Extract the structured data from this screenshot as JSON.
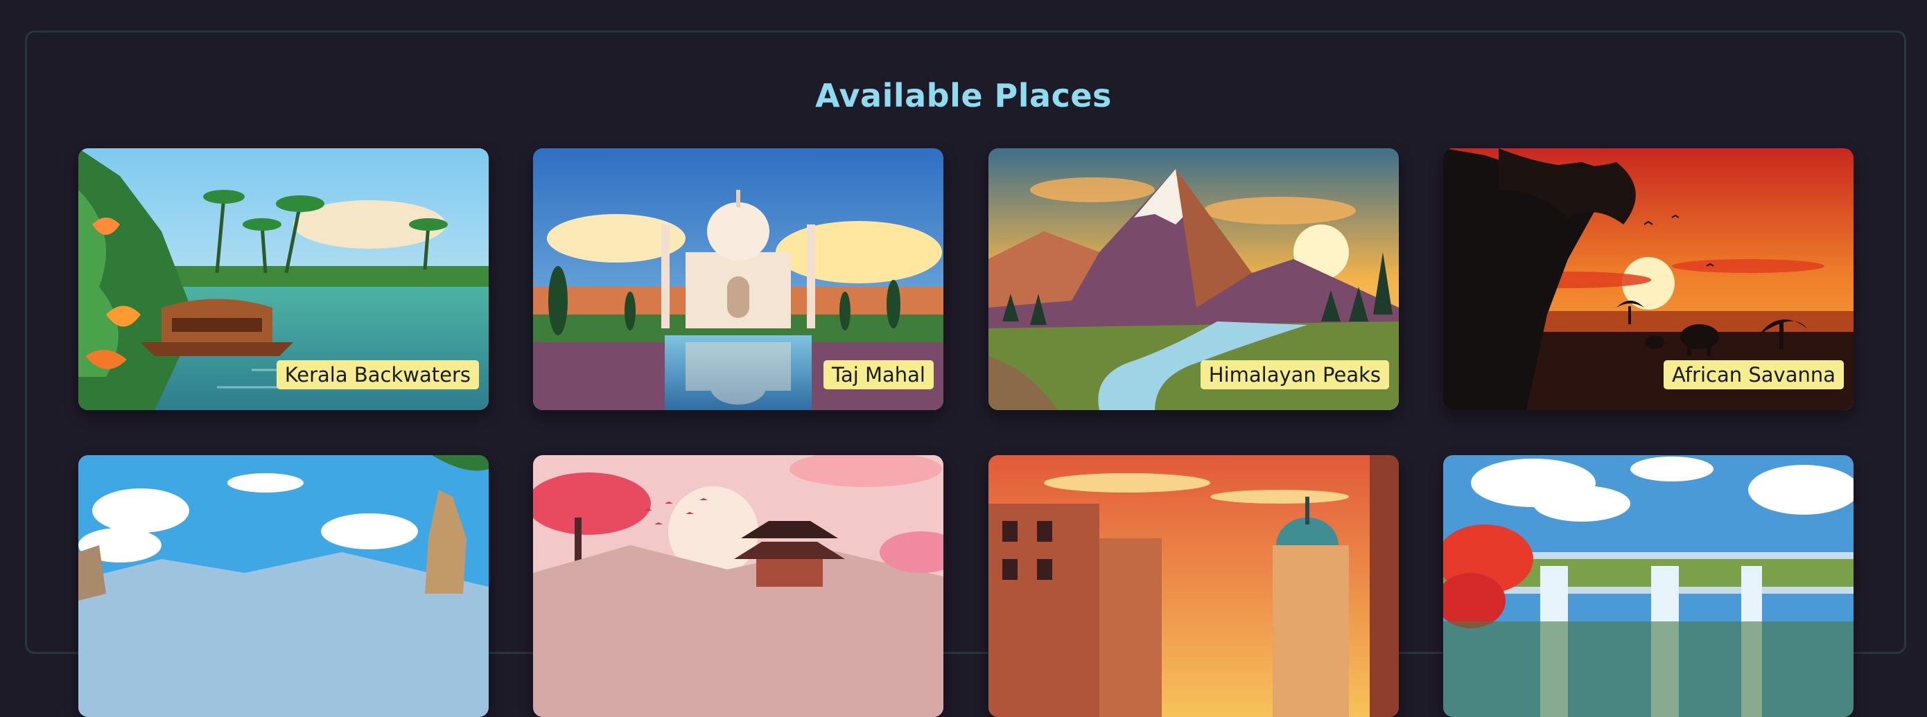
{
  "page": {
    "title": "Available Places"
  },
  "places": [
    {
      "name": "Kerala Backwaters",
      "image": "kerala-backwaters-image"
    },
    {
      "name": "Taj Mahal",
      "image": "taj-mahal-image"
    },
    {
      "name": "Himalayan Peaks",
      "image": "himalayan-peaks-image"
    },
    {
      "name": "African Savanna",
      "image": "african-savanna-image"
    },
    {
      "name": "",
      "image": "rocky-canyon-image"
    },
    {
      "name": "",
      "image": "japanese-pagoda-image"
    },
    {
      "name": "",
      "image": "venice-city-image"
    },
    {
      "name": "",
      "image": "waterfall-image"
    }
  ]
}
